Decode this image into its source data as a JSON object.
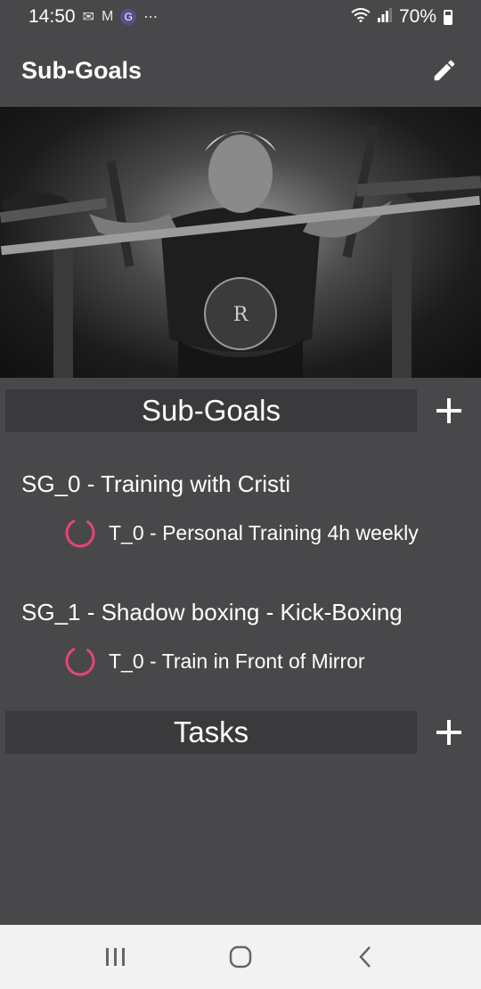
{
  "status_bar": {
    "time": "14:50",
    "battery": "70%",
    "icons": [
      "mail-icon",
      "gmail-icon",
      "g-app-icon",
      "more-dots-icon",
      "wifi-icon",
      "signal-icon",
      "battery-icon"
    ]
  },
  "app_bar": {
    "title": "Sub-Goals"
  },
  "subgoals_section": {
    "header": "Sub-Goals",
    "items": [
      {
        "title": "SG_0  -  Training with Cristi",
        "tasks": [
          {
            "label": "T_0  -  Personal Training 4h weekly"
          }
        ]
      },
      {
        "title": "SG_1  -  Shadow boxing - Kick-Boxing",
        "tasks": [
          {
            "label": "T_0  -  Train in Front of Mirror"
          }
        ]
      }
    ]
  },
  "tasks_section": {
    "header": "Tasks"
  },
  "colors": {
    "background": "#48484a",
    "header_bg": "#3a3a3c",
    "accent": "#e8437a",
    "nav_bg": "#f2f2f2"
  }
}
